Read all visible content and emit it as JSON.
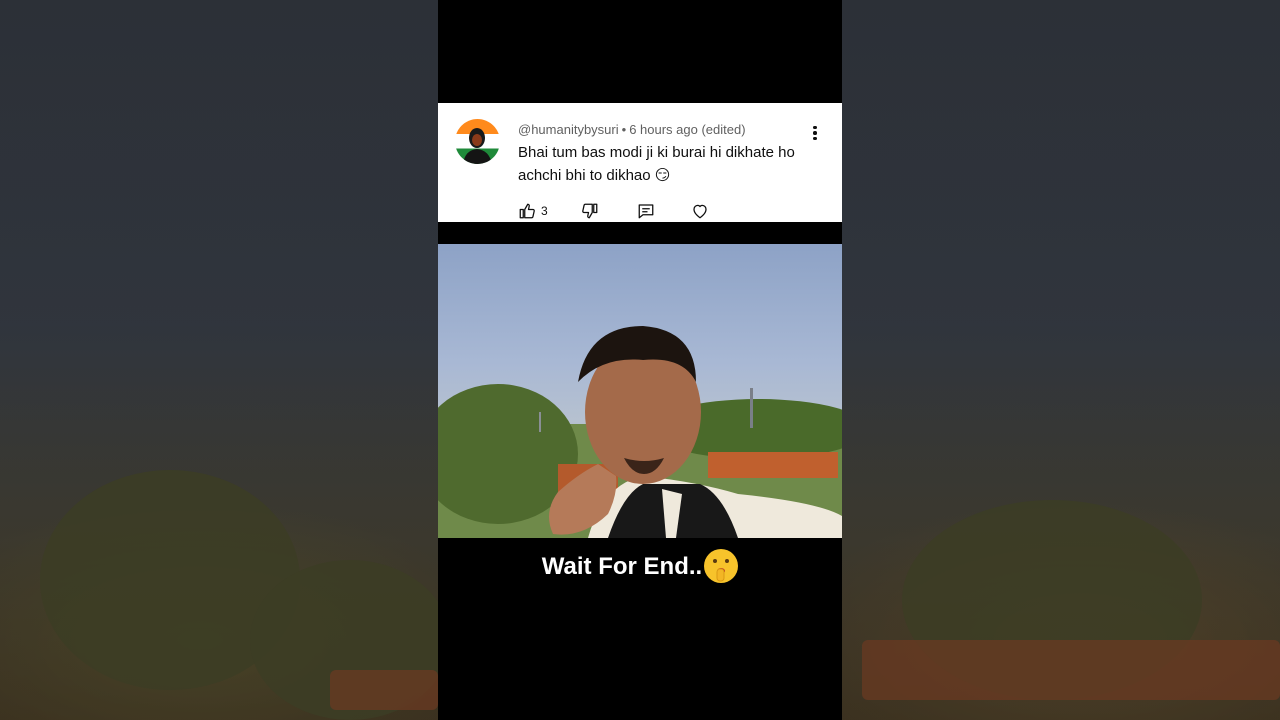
{
  "comment": {
    "username": "@humanitybysuri",
    "separator": "•",
    "timestamp": "6 hours ago (edited)",
    "text": "Bhai tum bas modi ji ki burai hi dikhate ho achchi bhi to dikhao",
    "text_emoji": "😏",
    "like_count": "3",
    "icons": {
      "avatar": "avatar",
      "more": "more-vert-icon",
      "like": "thumb-up-icon",
      "dislike": "thumb-down-icon",
      "reply": "reply-comment-icon",
      "heart": "heart-icon"
    }
  },
  "video": {
    "caption": "Wait For End..",
    "caption_emoji": "🤫"
  }
}
